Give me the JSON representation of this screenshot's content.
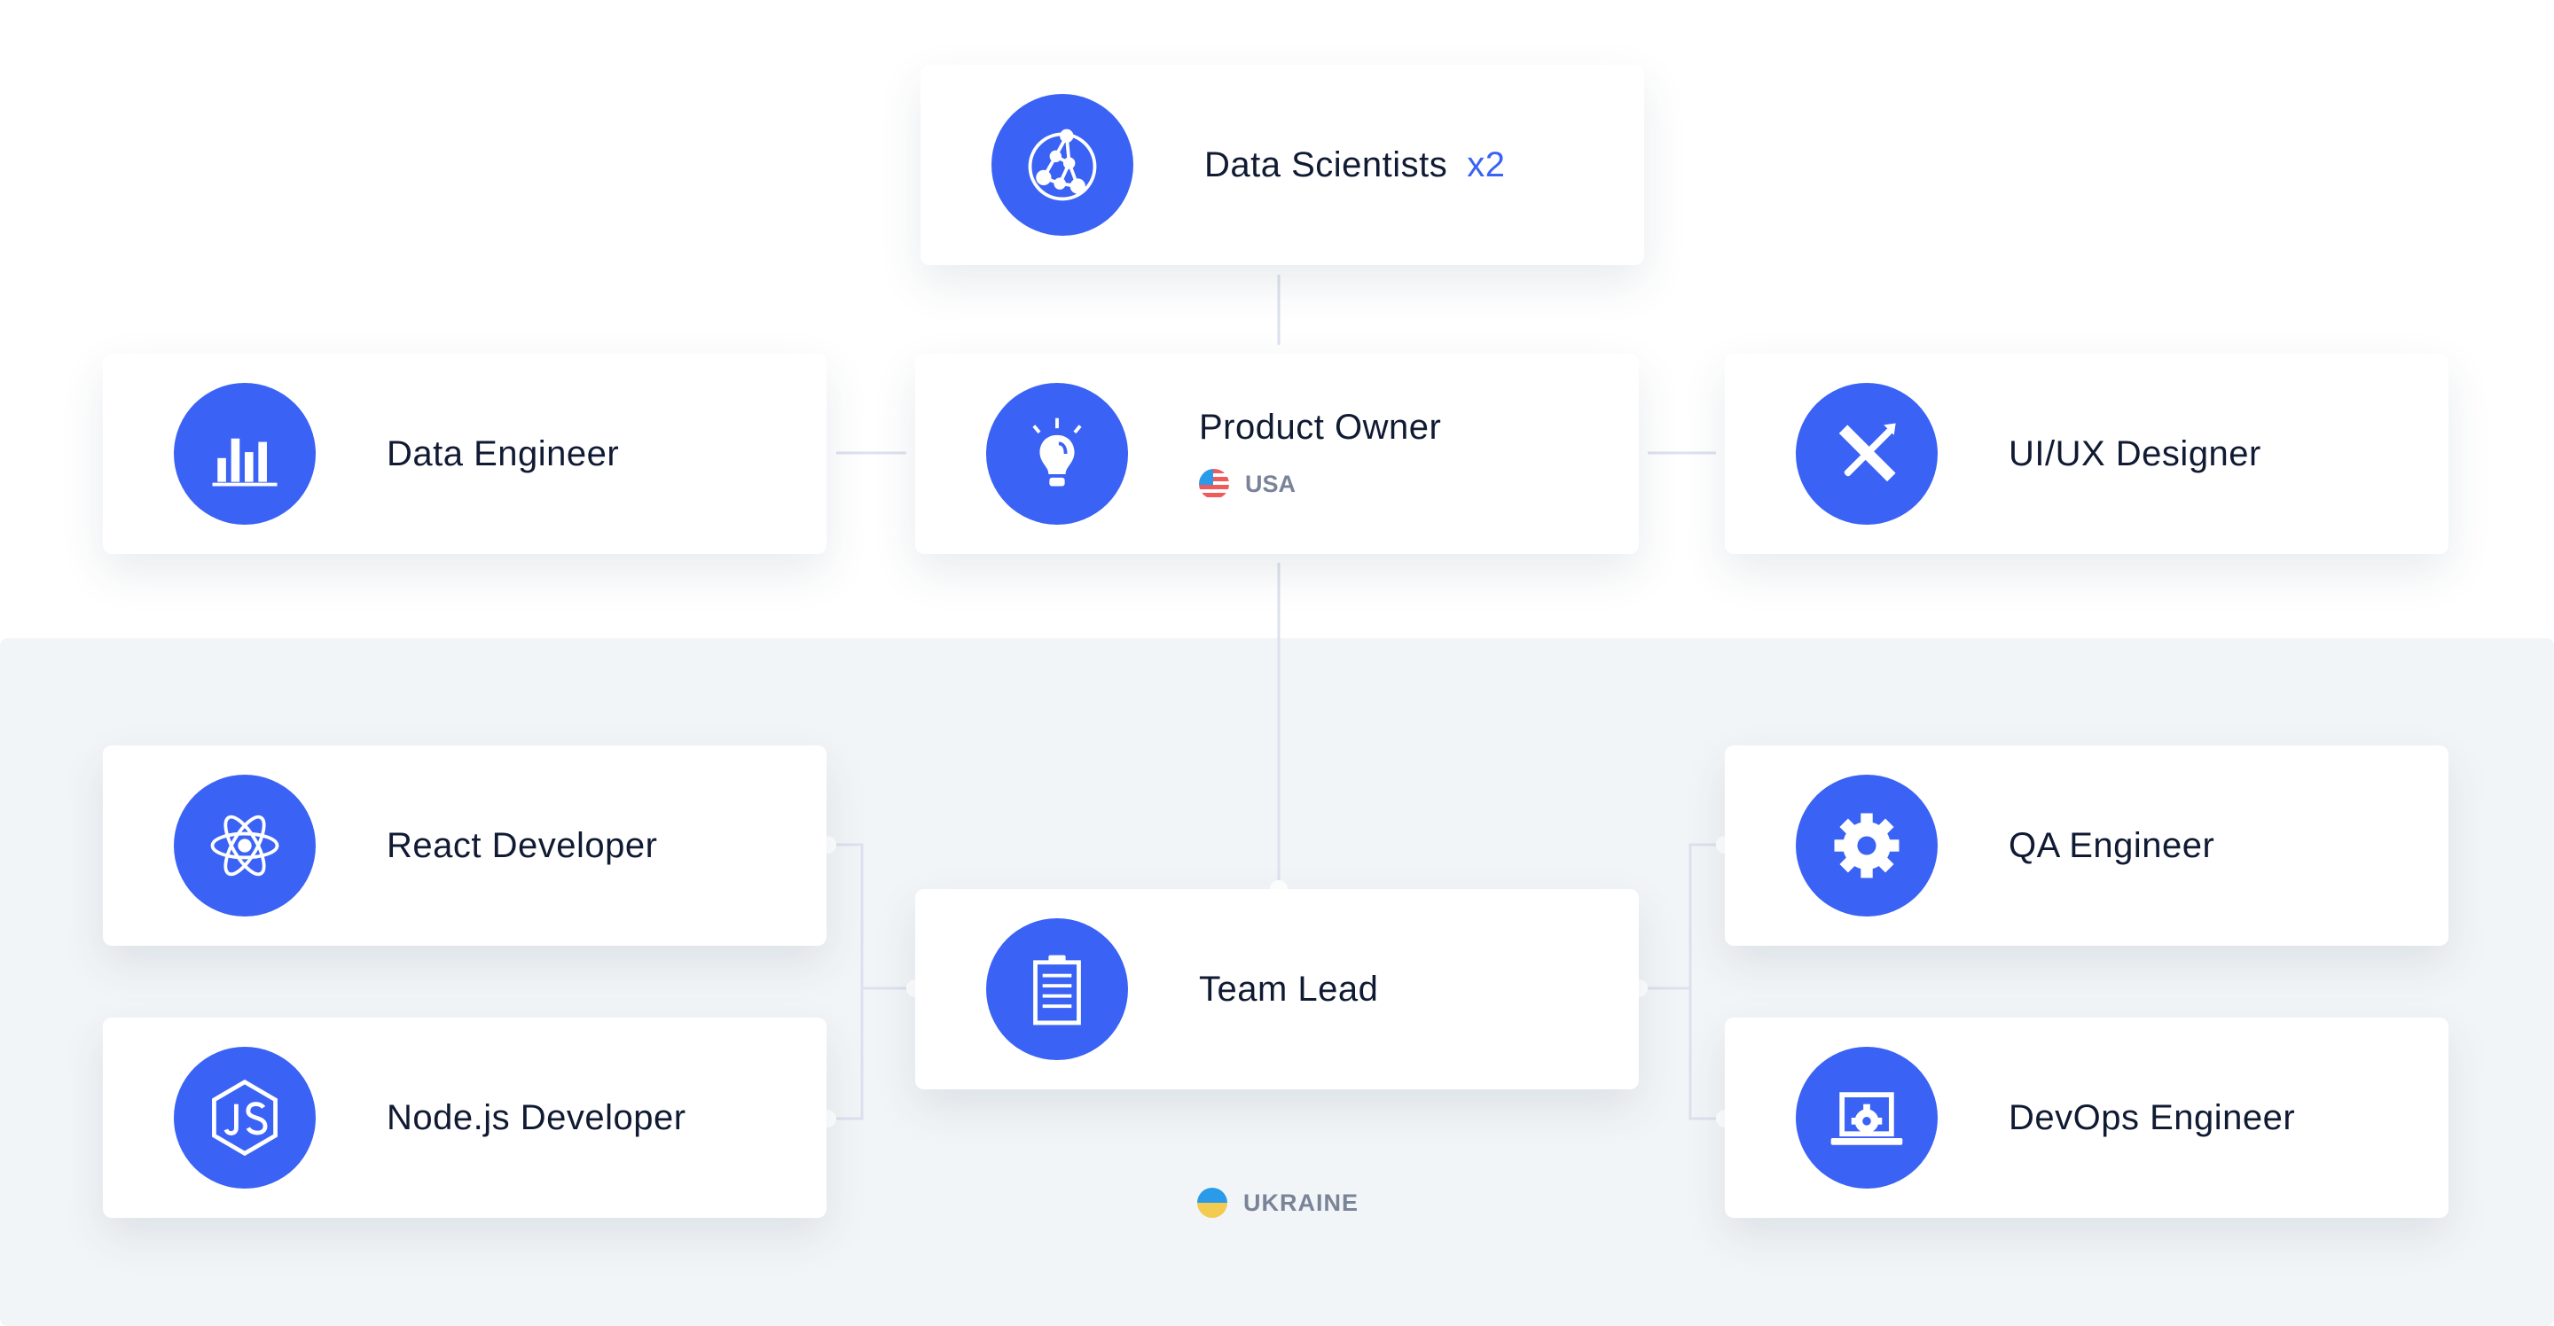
{
  "colors": {
    "accent": "#3a62f5",
    "text": "#101a33",
    "muted": "#7a8499",
    "band": "#f2f5f7",
    "connector": "#dde1ee"
  },
  "cards": {
    "data_scientists": {
      "label": "Data Scientists",
      "multiplier": "x2",
      "icon": "network-globe-icon"
    },
    "data_engineer": {
      "label": "Data Engineer",
      "icon": "bar-chart-icon"
    },
    "product_owner": {
      "label": "Product Owner",
      "location": "USA",
      "flag": "usa-flag-icon",
      "icon": "lightbulb-icon"
    },
    "ui_ux_designer": {
      "label": "UI/UX Designer",
      "icon": "ruler-brush-icon"
    },
    "react_developer": {
      "label": "React Developer",
      "icon": "react-atom-icon"
    },
    "nodejs_developer": {
      "label": "Node.js Developer",
      "icon": "nodejs-hexagon-icon"
    },
    "team_lead": {
      "label": "Team Lead",
      "icon": "clipboard-icon"
    },
    "qa_engineer": {
      "label": "QA Engineer",
      "icon": "gear-icon"
    },
    "devops_engineer": {
      "label": "DevOps Engineer",
      "icon": "laptop-gear-icon"
    }
  },
  "region": {
    "label": "UKRAINE",
    "flag": "ukraine-flag-icon"
  }
}
